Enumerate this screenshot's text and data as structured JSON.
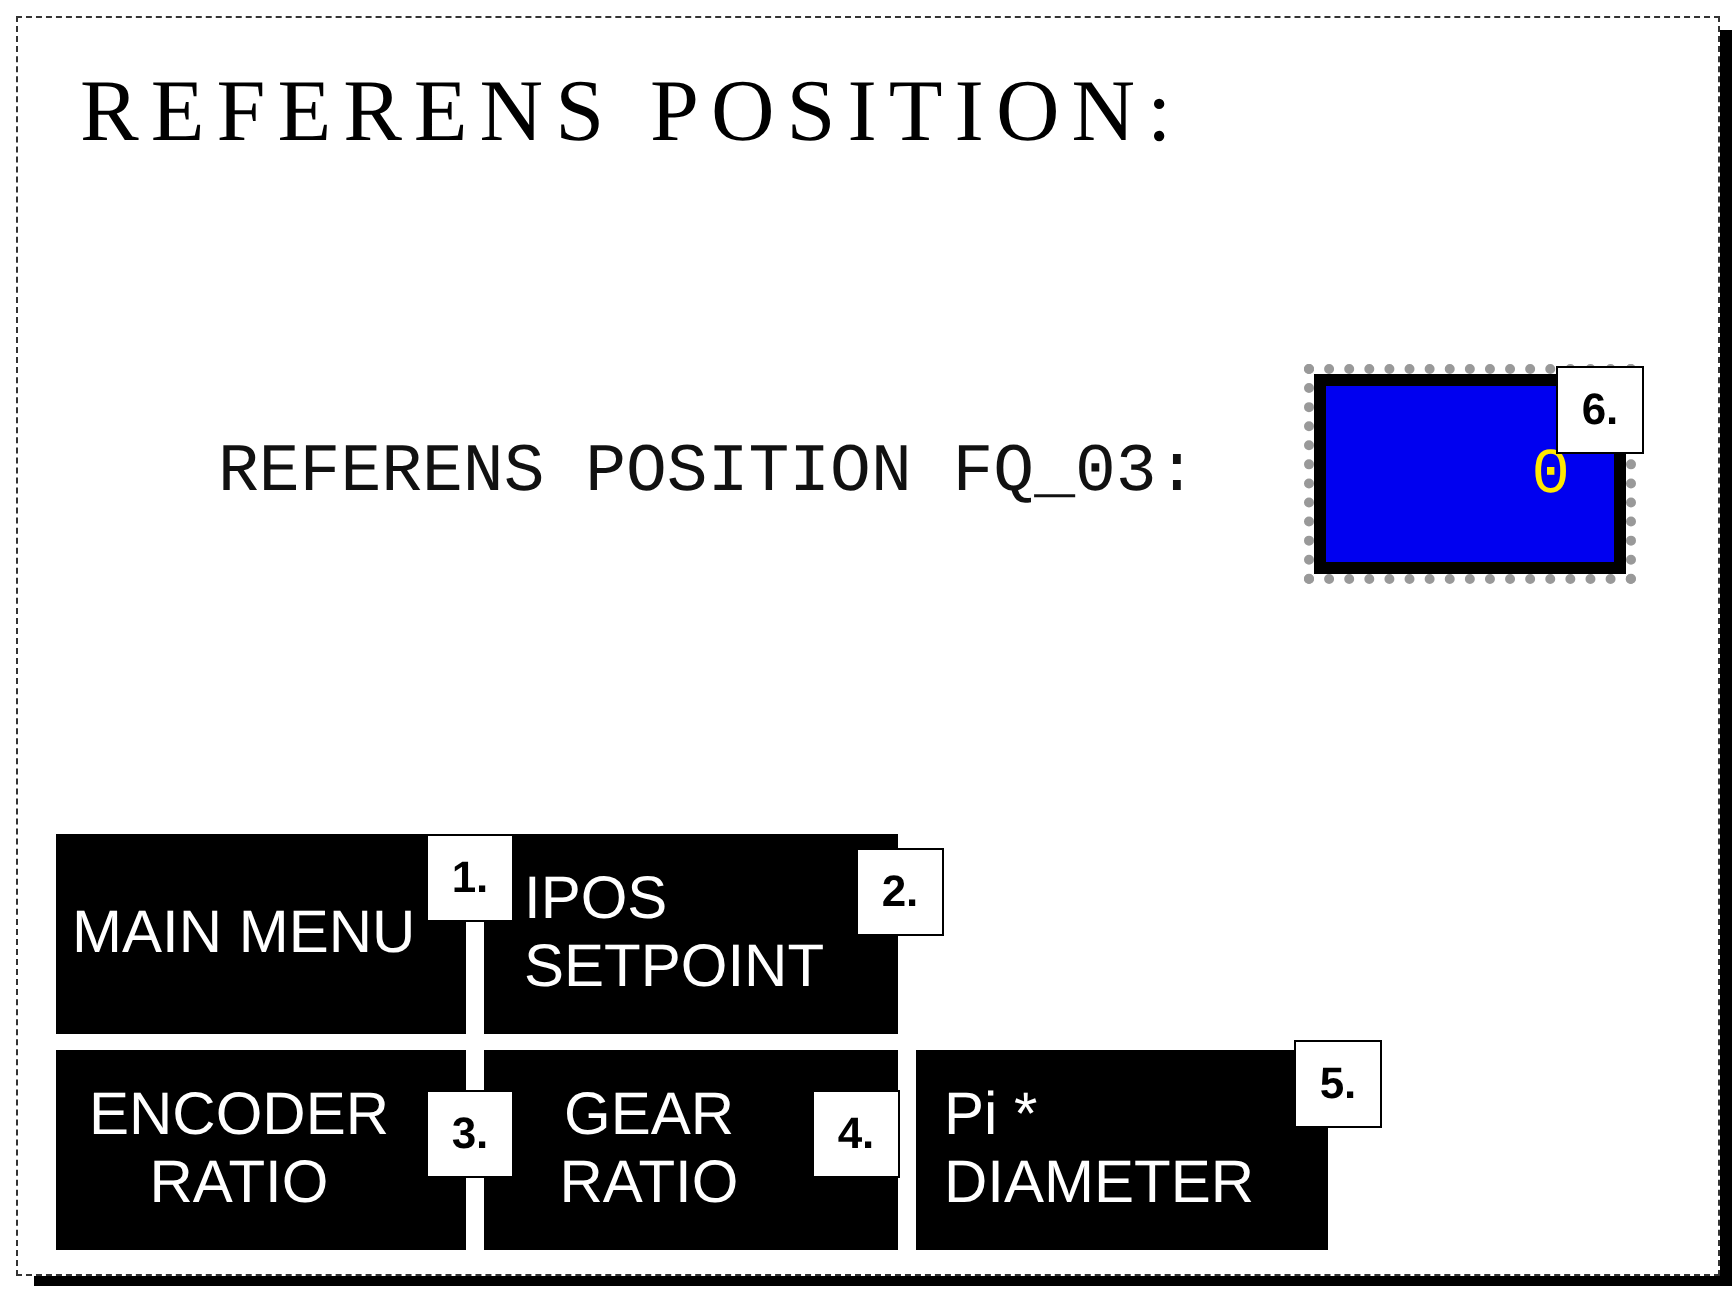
{
  "screen": {
    "title": "REFERENS POSITION:",
    "field": {
      "label": "REFERENS POSITION FQ_03:",
      "value": "0"
    },
    "buttons": [
      {
        "lines": [
          "MAIN MENU"
        ]
      },
      {
        "lines": [
          "IPOS",
          "SETPOINT"
        ]
      },
      {
        "lines": [
          "ENCODER",
          "RATIO"
        ]
      },
      {
        "lines": [
          "GEAR",
          "RATIO"
        ]
      },
      {
        "lines": [
          "Pi *",
          "DIAMETER"
        ]
      }
    ]
  },
  "callouts": [
    "1.",
    "2.",
    "3.",
    "4.",
    "5.",
    "6."
  ]
}
